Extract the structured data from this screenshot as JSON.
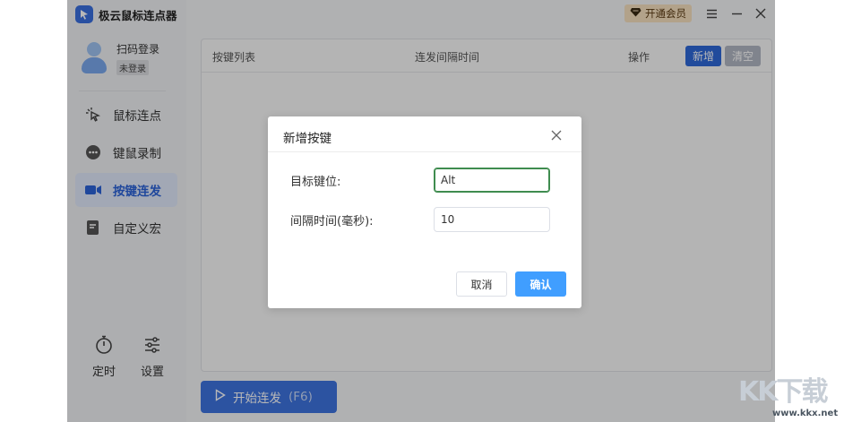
{
  "app": {
    "title": "极云鼠标连点器"
  },
  "user": {
    "login_label": "扫码登录",
    "status_badge": "未登录"
  },
  "sidebar": {
    "items": [
      {
        "label": "鼠标连点",
        "icon": "pointer-click-icon",
        "active": false
      },
      {
        "label": "键鼠录制",
        "icon": "gamepad-icon",
        "active": false
      },
      {
        "label": "按键连发",
        "icon": "video-camera-icon",
        "active": true
      },
      {
        "label": "自定义宏",
        "icon": "document-edit-icon",
        "active": false
      }
    ],
    "bottom": [
      {
        "label": "定时",
        "icon": "stopwatch-icon"
      },
      {
        "label": "设置",
        "icon": "sliders-icon"
      }
    ]
  },
  "header": {
    "vip_label": "开通会员"
  },
  "table": {
    "columns": [
      "按键列表",
      "连发间隔时间",
      "操作"
    ],
    "add_label": "新增",
    "clear_label": "清空"
  },
  "start": {
    "label": "开始连发",
    "hotkey": "(F6)"
  },
  "dialog": {
    "title": "新增按键",
    "key_label": "目标键位:",
    "key_value": "Alt",
    "interval_label": "间隔时间(毫秒):",
    "interval_value": "10",
    "cancel_label": "取消",
    "ok_label": "确认"
  },
  "watermark": {
    "text": "KK下载",
    "url": "www.kkx.net"
  },
  "colors": {
    "accent": "#2f68d9",
    "confirm": "#409eff",
    "active_bg": "#e1e9fb"
  }
}
